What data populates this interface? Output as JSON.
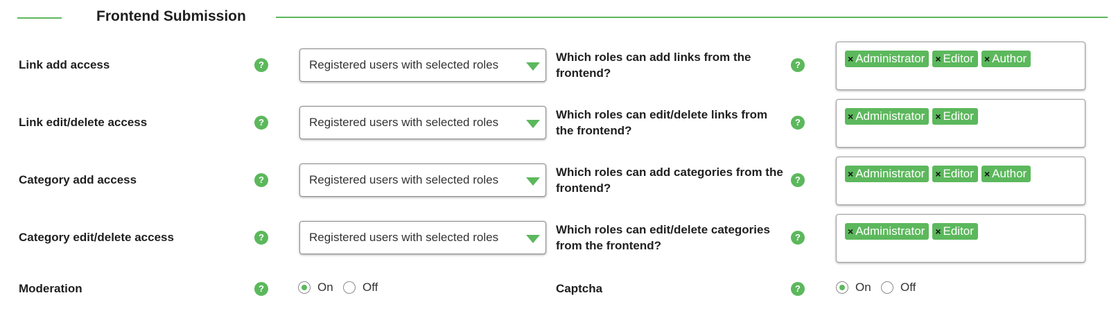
{
  "section": {
    "title": "Frontend Submission"
  },
  "colors": {
    "accent": "#5cb85c"
  },
  "help_icon": {
    "glyph": "?",
    "name": "question-circle-icon"
  },
  "access_rows": [
    {
      "label": "Link add access",
      "select_value": "Registered users with selected roles",
      "question": "Which roles can add links from the frontend?",
      "tags": [
        "Administrator",
        "Editor",
        "Author"
      ]
    },
    {
      "label": "Link edit/delete access",
      "select_value": "Registered users with selected roles",
      "question": "Which roles can edit/delete links from the frontend?",
      "tags": [
        "Administrator",
        "Editor"
      ]
    },
    {
      "label": "Category add access",
      "select_value": "Registered users with selected roles",
      "question": "Which roles can add categories from the frontend?",
      "tags": [
        "Administrator",
        "Editor",
        "Author"
      ]
    },
    {
      "label": "Category edit/delete access",
      "select_value": "Registered users with selected roles",
      "question": "Which roles can edit/delete categories from the frontend?",
      "tags": [
        "Administrator",
        "Editor"
      ]
    }
  ],
  "moderation": {
    "label": "Moderation",
    "on_label": "On",
    "off_label": "Off",
    "selected": "On"
  },
  "captcha": {
    "label": "Captcha",
    "on_label": "On",
    "off_label": "Off",
    "selected": "On"
  },
  "tag_remove_glyph": "×"
}
